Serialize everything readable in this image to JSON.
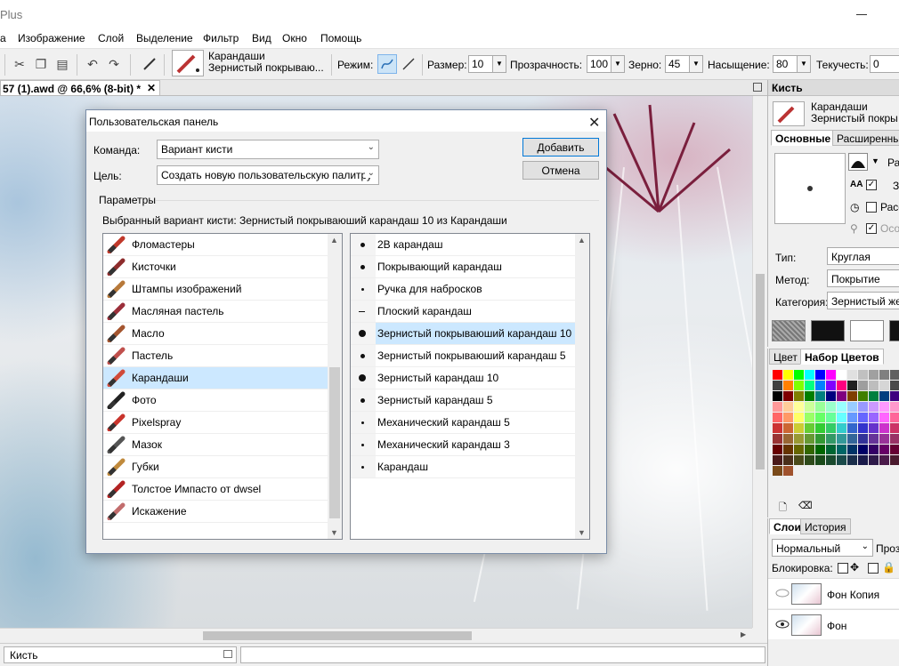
{
  "app": {
    "title_fragment": "Plus"
  },
  "menu": [
    "а",
    "Изображение",
    "Слой",
    "Выделение",
    "Фильтр",
    "Вид",
    "Окно",
    "Помощь"
  ],
  "toolbar": {
    "brush_category": "Карандаши",
    "brush_variant": "Зернистый покрываю...",
    "mode_label": "Режим:",
    "size_label": "Размер:",
    "size_value": "10",
    "opacity_label": "Прозрачность:",
    "opacity_value": "100",
    "grain_label": "Зерно:",
    "grain_value": "45",
    "saturation_label": "Насыщение:",
    "saturation_value": "80",
    "flow_label": "Текучесть:",
    "flow_value": "0"
  },
  "document": {
    "tab_title": "57 (1).awd @ 66,6% (8-bit) *",
    "close_glyph": "✕"
  },
  "statusbar": {
    "tool": "Кисть"
  },
  "dialog": {
    "title": "Пользовательская панель",
    "command_label": "Команда:",
    "command_value": "Вариант кисти",
    "target_label": "Цель:",
    "target_value": "Создать новую пользовательскую палитру",
    "add_button": "Добавить",
    "cancel_button": "Отмена",
    "params_label": "Параметры",
    "selected_info": "Выбранный вариант кисти: Зернистый покрываюший карандаш 10 из Карандаши",
    "categories": [
      {
        "label": "Фломастеры",
        "color": "#c0392b"
      },
      {
        "label": "Кисточки",
        "color": "#8e2d2d"
      },
      {
        "label": "Штампы изображений",
        "color": "#b7793a"
      },
      {
        "label": "Масляная пастель",
        "color": "#9b2f3a"
      },
      {
        "label": "Масло",
        "color": "#a4552f"
      },
      {
        "label": "Пастель",
        "color": "#c0504d"
      },
      {
        "label": "Карандаши",
        "color": "#d04a3a"
      },
      {
        "label": "Фото",
        "color": "#222222"
      },
      {
        "label": "Pixelspray",
        "color": "#c8342c"
      },
      {
        "label": "Мазок",
        "color": "#555555"
      },
      {
        "label": "Губки",
        "color": "#c08a3c"
      },
      {
        "label": "Толстое Импасто от dwsel",
        "color": "#b32323"
      },
      {
        "label": "Искажение",
        "color": "#c26d6d"
      }
    ],
    "selected_category": 6,
    "variants": [
      {
        "label": "2B карандаш",
        "dot": 5
      },
      {
        "label": "Покрывающий карандаш",
        "dot": 5
      },
      {
        "label": "Ручка для набросков",
        "dot": 3
      },
      {
        "label": "Плоский карандаш",
        "dot": 0
      },
      {
        "label": "Зернистый покрываюший карандаш 10",
        "dot": 8
      },
      {
        "label": "Зернистый покрываюший карандаш 5",
        "dot": 5
      },
      {
        "label": "Зернистый карандаш 10",
        "dot": 8
      },
      {
        "label": "Зернистый карандаш 5",
        "dot": 5
      },
      {
        "label": "Механический карандаш 5",
        "dot": 3
      },
      {
        "label": "Механический карандаш 3",
        "dot": 3
      },
      {
        "label": "Карандаш",
        "dot": 3
      }
    ],
    "selected_variant": 4
  },
  "brush_panel": {
    "title": "Кисть",
    "category": "Карандаши",
    "variant": "Зернистый покры",
    "tab_basic": "Основные",
    "tab_advanced": "Расширенны",
    "size_short": "Ра",
    "opt1_short": "З",
    "opt2_short": "Расс",
    "opt3_short": "Осо",
    "type_label": "Тип:",
    "type_value": "Круглая",
    "method_label": "Метод:",
    "method_value": "Покрытие",
    "category_label": "Категория:",
    "category_value": "Зернистый же"
  },
  "color_panel": {
    "tab_color": "Цвет",
    "tab_sets": "Набор Цветов",
    "swatches": [
      "#ff0000",
      "#ffff00",
      "#00ff00",
      "#00ffff",
      "#0000ff",
      "#ff00ff",
      "#ffffff",
      "#e0e0e0",
      "#c0c0c0",
      "#a0a0a0",
      "#808080",
      "#606060",
      "#404040",
      "#ff8000",
      "#80ff00",
      "#00ff80",
      "#0080ff",
      "#8000ff",
      "#ff0080",
      "#202020",
      "#9e9e9e",
      "#bdbdbd",
      "#d6d6d6",
      "#4a4a4a",
      "#000000",
      "#7f0000",
      "#7f7f00",
      "#007f00",
      "#007f7f",
      "#00007f",
      "#7f007f",
      "#7f3f00",
      "#3f7f00",
      "#007f3f",
      "#003f7f",
      "#3f007f",
      "#ff9999",
      "#ffcc99",
      "#ffff99",
      "#ccff99",
      "#99ff99",
      "#99ffcc",
      "#99ffff",
      "#99ccff",
      "#9999ff",
      "#cc99ff",
      "#ff99ff",
      "#ff99cc",
      "#ff6666",
      "#ff9966",
      "#ffff66",
      "#99ff66",
      "#66ff66",
      "#66ff99",
      "#66ffff",
      "#6699ff",
      "#6666ff",
      "#9966ff",
      "#ff66ff",
      "#ff6699",
      "#cc3333",
      "#cc6633",
      "#cccc33",
      "#66cc33",
      "#33cc33",
      "#33cc66",
      "#33cccc",
      "#3366cc",
      "#3333cc",
      "#6633cc",
      "#cc33cc",
      "#cc3366",
      "#993333",
      "#996633",
      "#999933",
      "#669933",
      "#339933",
      "#339966",
      "#339999",
      "#336699",
      "#333399",
      "#663399",
      "#993399",
      "#993366",
      "#660000",
      "#663300",
      "#666600",
      "#336600",
      "#006600",
      "#006633",
      "#006666",
      "#003366",
      "#000066",
      "#330066",
      "#660066",
      "#660033",
      "#4a1a1a",
      "#4a2e1a",
      "#4a4a1a",
      "#2e4a1a",
      "#1a4a1a",
      "#1a4a2e",
      "#1a4a4a",
      "#1a2e4a",
      "#1a1a4a",
      "#2e1a4a",
      "#4a1a4a",
      "#4a1a2e",
      "#7a4a1a",
      "#a0522d"
    ]
  },
  "layers_panel": {
    "tab_layers": "Слои",
    "tab_history": "История",
    "blend_mode": "Нормальный",
    "opacity_short": "Проз",
    "lock_label": "Блокировка:",
    "layers": [
      {
        "name": "Фон Копия",
        "visible": false
      },
      {
        "name": "Фон",
        "visible": true
      }
    ]
  }
}
